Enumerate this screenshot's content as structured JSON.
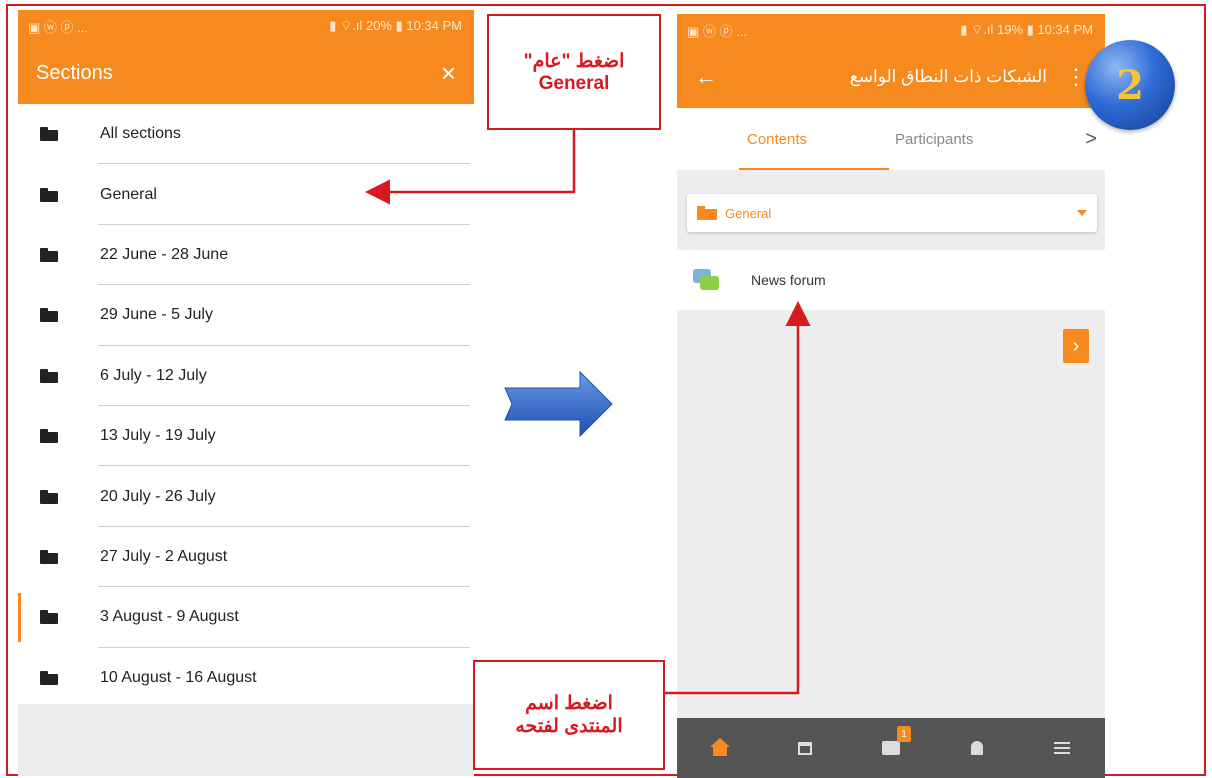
{
  "left_screen": {
    "status": {
      "left": "▣ ⓦ ⓟ ...",
      "right": "▮ ⌔.ıl 20% ▮ 10:34 PM"
    },
    "toolbar": {
      "title": "Sections",
      "close_label": "×"
    },
    "sections": [
      {
        "label": "All sections"
      },
      {
        "label": "General"
      },
      {
        "label": "22 June - 28 June"
      },
      {
        "label": "29 June - 5 July"
      },
      {
        "label": "6 July - 12 July"
      },
      {
        "label": "13 July - 19 July"
      },
      {
        "label": "20 July - 26 July"
      },
      {
        "label": "27 July - 2 August"
      },
      {
        "label": "3 August - 9 August"
      },
      {
        "label": "10 August - 16 August"
      }
    ]
  },
  "right_screen": {
    "status": {
      "left": "▣ ⓦ ⓟ ...",
      "right": "▮ ⌔.ıl 19% ▮ 10:34 PM"
    },
    "toolbar": {
      "back_label": "←",
      "title": "الشبكات ذات النطاق الواسع",
      "more_label": "⋮"
    },
    "tabs": {
      "contents": "Contents",
      "participants": "Participants",
      "chevron": ">"
    },
    "section_select": {
      "value": "General"
    },
    "module": {
      "label": "News forum"
    },
    "next_label": "›",
    "nav_badge": "1"
  },
  "callouts": {
    "top_line1": "اضغط \"عام\"",
    "top_line2": "General",
    "bottom_line1": "اضغط اسم",
    "bottom_line2": "المنتدى لفتحه"
  },
  "step_number": "2",
  "colors": {
    "accent": "#f68a1e",
    "annotation": "#d71920",
    "arrow_blue": "#2e6bd6"
  },
  "icons": [
    "folder-icon",
    "close-icon",
    "back-arrow-icon",
    "more-icon",
    "forum-icon",
    "home-icon",
    "calendar-icon",
    "messages-icon",
    "bell-icon",
    "menu-icon"
  ]
}
